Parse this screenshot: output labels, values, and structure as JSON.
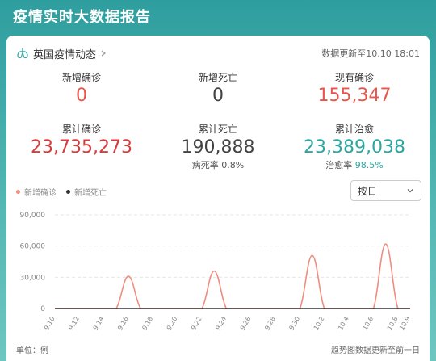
{
  "header": {
    "title": "疫情实时大数据报告"
  },
  "card": {
    "title": "英国疫情动态",
    "update_time": "数据更新至10.10 18:01"
  },
  "stats": {
    "new_confirmed": {
      "label": "新增确诊",
      "value": "0"
    },
    "new_deaths": {
      "label": "新增死亡",
      "value": "0"
    },
    "current_confirmed": {
      "label": "现有确诊",
      "value": "155,347"
    },
    "total_confirmed": {
      "label": "累计确诊",
      "value": "23,735,273"
    },
    "total_deaths": {
      "label": "累计死亡",
      "value": "190,888",
      "sub_label": "病死率",
      "sub_value": "0.8%"
    },
    "total_cured": {
      "label": "累计治愈",
      "value": "23,389,038",
      "sub_label": "治愈率",
      "sub_value": "98.5%"
    }
  },
  "legend": {
    "new_confirmed": "新增确诊",
    "new_deaths": "新增死亡"
  },
  "select": {
    "value": "按日"
  },
  "footer": {
    "unit": "单位：例",
    "note": "趋势图数据更新至前一日"
  },
  "colors": {
    "confirmed": "#f08d7f",
    "deaths": "#333333",
    "accent": "#2aa7a0"
  },
  "chart_data": {
    "type": "line",
    "x": [
      "9.10",
      "9.11",
      "9.12",
      "9.13",
      "9.14",
      "9.15",
      "9.16",
      "9.17",
      "9.18",
      "9.19",
      "9.20",
      "9.21",
      "9.22",
      "9.23",
      "9.24",
      "9.25",
      "9.26",
      "9.27",
      "9.28",
      "9.29",
      "9.30",
      "10.1",
      "10.2",
      "10.3",
      "10.4",
      "10.5",
      "10.6",
      "10.7",
      "10.8",
      "10.9"
    ],
    "tick_labels": [
      "9.10",
      "9.12",
      "9.14",
      "9.16",
      "9.18",
      "9.20",
      "9.22",
      "9.24",
      "9.26",
      "9.28",
      "9.30",
      "10.2",
      "10.4",
      "10.6",
      "10.8",
      "10.9"
    ],
    "series": [
      {
        "name": "新增确诊",
        "values": [
          0,
          0,
          0,
          0,
          0,
          0,
          31000,
          0,
          0,
          0,
          0,
          0,
          0,
          36000,
          0,
          0,
          0,
          0,
          0,
          0,
          0,
          51000,
          0,
          0,
          0,
          0,
          0,
          62000,
          0,
          0
        ]
      },
      {
        "name": "新增死亡",
        "values": [
          0,
          0,
          0,
          0,
          0,
          0,
          0,
          0,
          0,
          0,
          0,
          0,
          0,
          0,
          0,
          0,
          0,
          0,
          0,
          0,
          0,
          0,
          0,
          0,
          0,
          0,
          0,
          0,
          0,
          0
        ]
      }
    ],
    "y_ticks": [
      "0",
      "30,000",
      "60,000",
      "90,000"
    ],
    "ylim": [
      0,
      90000
    ],
    "grid": true
  }
}
